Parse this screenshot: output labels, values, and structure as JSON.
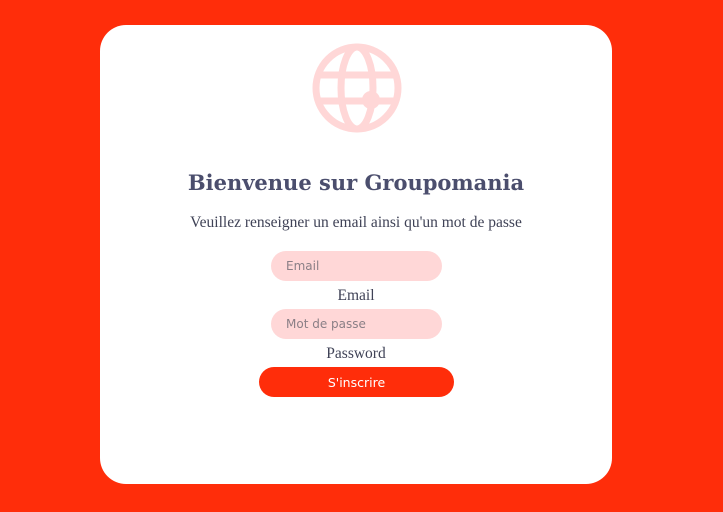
{
  "brand": {
    "logo_icon": "globe-icon",
    "accent_color": "#ff2d0a",
    "logo_color": "#ffd7d7"
  },
  "signup": {
    "title": "Bienvenue sur Groupomania",
    "subtitle": "Veuillez renseigner un email ainsi qu'un mot de passe",
    "email_placeholder": "Email",
    "email_value": "",
    "email_label": "Email",
    "password_placeholder": "Mot de passe",
    "password_value": "",
    "password_label": "Password",
    "submit_label": "S'inscrire"
  }
}
